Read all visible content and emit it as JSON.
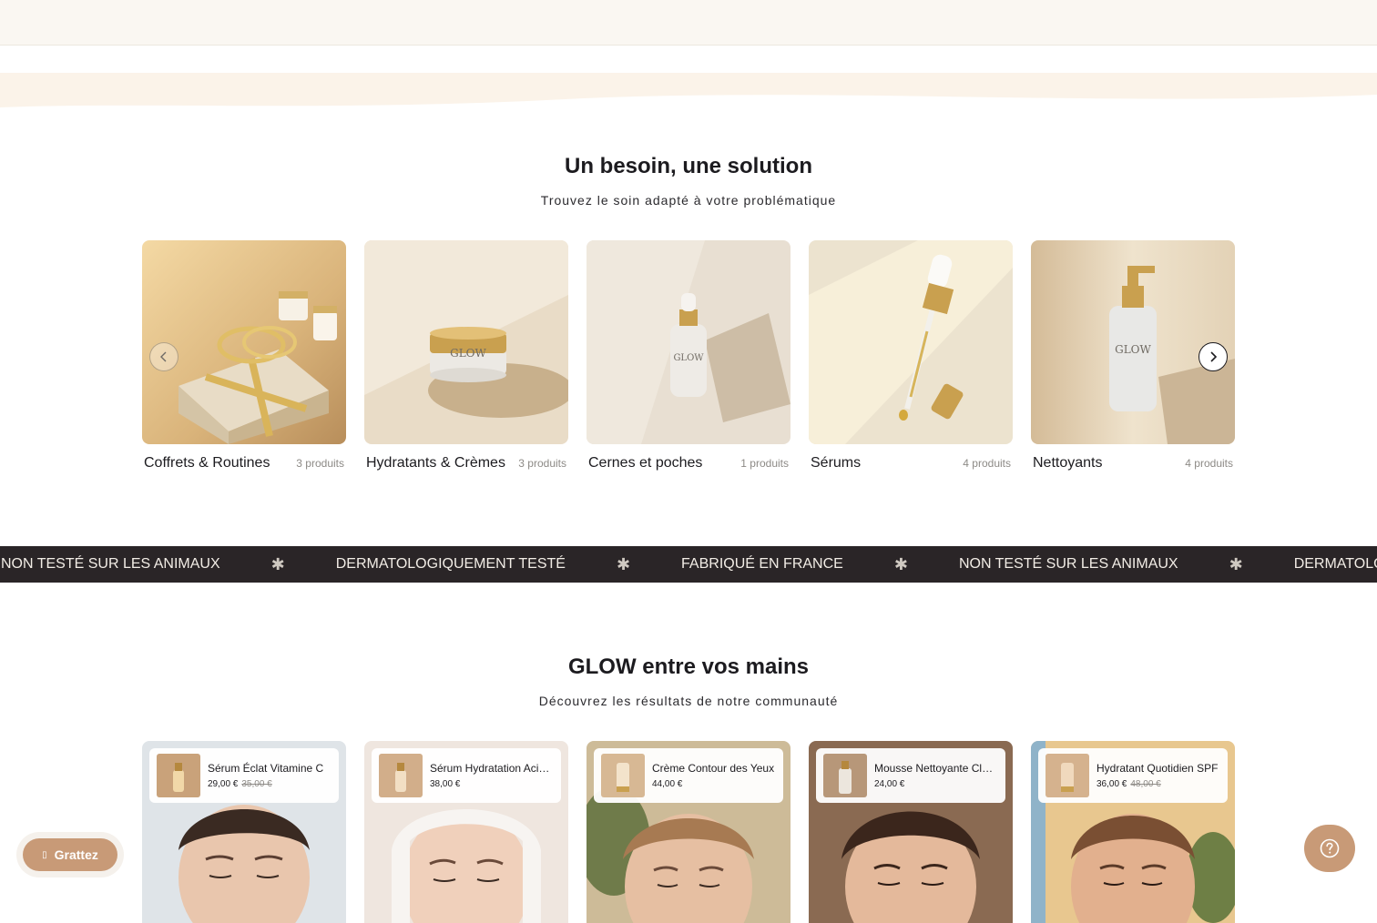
{
  "top_bar": {
    "cut_text": ""
  },
  "categories_section": {
    "title": "Un besoin, une solution",
    "subtitle": "Trouvez le soin adapté à votre problématique",
    "items": [
      {
        "name": "Coffrets & Routines",
        "count": "3 produits"
      },
      {
        "name": "Hydratants & Crèmes",
        "count": "3 produits"
      },
      {
        "name": "Cernes et poches",
        "count": "1 produits"
      },
      {
        "name": "Sérums",
        "count": "4 produits"
      },
      {
        "name": "Nettoyants",
        "count": "4 produits"
      }
    ],
    "product_brand": "GLOW"
  },
  "marquee": {
    "items": [
      "NON TESTÉ SUR LES ANIMAUX",
      "DERMATOLOGIQUEMENT TESTÉ",
      "FABRIQUÉ EN FRANCE",
      "NON TESTÉ SUR LES ANIMAUX",
      "DERMATOLOGIQUEMENT TESTÉ"
    ],
    "separator": "✱"
  },
  "community_section": {
    "title": "GLOW entre vos mains",
    "subtitle": "Découvrez les résultats de notre communauté",
    "cards": [
      {
        "product": "Sérum Éclat Vitamine C",
        "price": "29,00 €",
        "old_price": "35,00 €"
      },
      {
        "product": "Sérum Hydratation Acide Hyaluronique",
        "price": "38,00 €",
        "old_price": ""
      },
      {
        "product": "Crème Contour des Yeux",
        "price": "44,00 €",
        "old_price": ""
      },
      {
        "product": "Mousse Nettoyante Clarifiante",
        "price": "24,00 €",
        "old_price": ""
      },
      {
        "product": "Hydratant Quotidien SPF",
        "price": "36,00 €",
        "old_price": "48,00 €"
      }
    ]
  },
  "floating": {
    "scratch_label": "Grattez",
    "scratch_icon": "gift-icon",
    "help_icon": "question-icon"
  },
  "colors": {
    "accent": "#c89a77",
    "marquee_bg": "#2a2527",
    "cream": "#faf7f2"
  }
}
